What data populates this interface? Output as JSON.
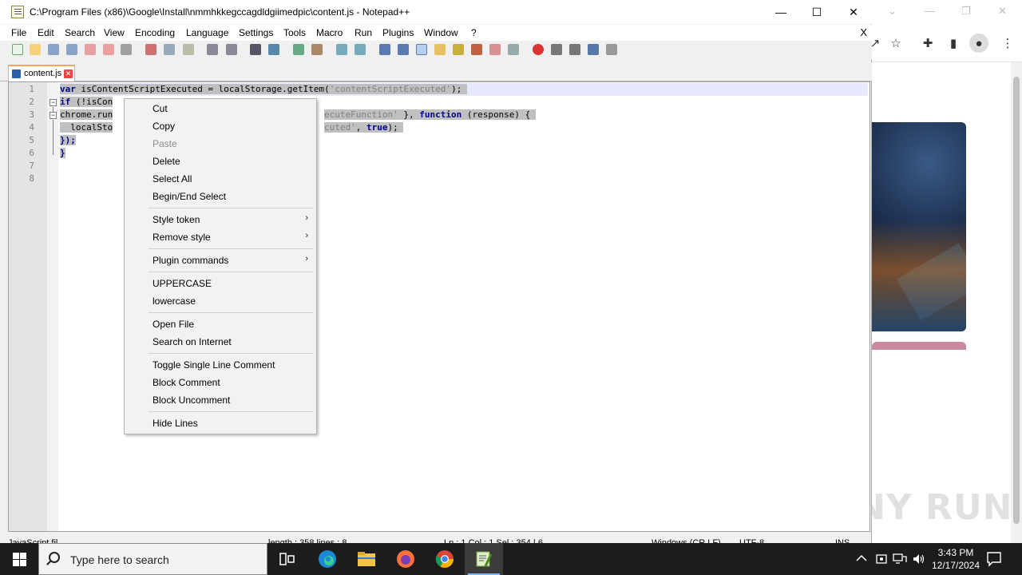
{
  "notepad": {
    "title": "C:\\Program Files (x86)\\Google\\Install\\nmmhkkegccagdldgiimedpic\\content.js - Notepad++",
    "menu": [
      "File",
      "Edit",
      "Search",
      "View",
      "Encoding",
      "Language",
      "Settings",
      "Tools",
      "Macro",
      "Run",
      "Plugins",
      "Window",
      "?"
    ],
    "menu_close": "X",
    "tab_label": "content.js",
    "line_numbers": [
      "1",
      "2",
      "3",
      "4",
      "5",
      "6",
      "7",
      "8"
    ],
    "code": {
      "l1_kw": "var",
      "l1_a": " isContentScriptExecuted = localStorage.getItem(",
      "l1_str": "'contentScriptExecuted'",
      "l1_b": ");",
      "l2_kw": "if",
      "l2_a": " (!isCon",
      "l3_a": "chrome.run",
      "l3_str": "ecuteFunction'",
      "l3_b": " }, ",
      "l3_kw": "function",
      "l3_c": " (response) {",
      "l4_a": "  localSto",
      "l4_str": "cuted'",
      "l4_b": ", ",
      "l4_kw": "true",
      "l4_c": ");",
      "l5": "});",
      "l6": "}"
    },
    "status": {
      "type": "JavaScript fil",
      "length": "length : 358    lines : 8",
      "position": "Ln : 1    Col : 1    Sel : 354 | 6",
      "eol": "Windows (CR LF)",
      "encoding": "UTF-8",
      "mode": "INS"
    }
  },
  "context_menu": {
    "cut": "Cut",
    "copy": "Copy",
    "paste": "Paste",
    "delete": "Delete",
    "select_all": "Select All",
    "begin_end_select": "Begin/End Select",
    "style_token": "Style token",
    "remove_style": "Remove style",
    "plugin_commands": "Plugin commands",
    "uppercase": "UPPERCASE",
    "lowercase": "lowercase",
    "open_file": "Open File",
    "search_internet": "Search on Internet",
    "toggle_comment": "Toggle Single Line Comment",
    "block_comment": "Block Comment",
    "block_uncomment": "Block Uncomment",
    "hide_lines": "Hide Lines",
    "submenu_arrow": "›"
  },
  "watermark": "ANY RUN",
  "taskbar": {
    "search_placeholder": "Type here to search",
    "time": "3:43 PM",
    "date": "12/17/2024"
  },
  "colors": {
    "accent": "#7ab7ff",
    "keyword": "#00008b",
    "string": "#808080",
    "selection": "#c0c0c0"
  }
}
